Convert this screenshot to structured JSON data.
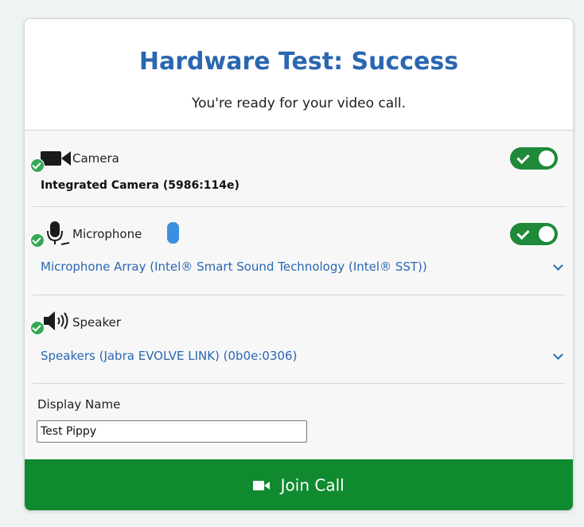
{
  "header": {
    "title": "Hardware Test: Success",
    "subtitle": "You're ready for your video call."
  },
  "camera": {
    "label": "Camera",
    "device": "Integrated Camera (5986:114e)",
    "enabled": true,
    "status": "ok"
  },
  "microphone": {
    "label": "Microphone",
    "device": "Microphone Array (Intel® Smart Sound Technology (Intel® SST))",
    "enabled": true,
    "status": "ok"
  },
  "speaker": {
    "label": "Speaker",
    "device": "Speakers (Jabra EVOLVE LINK) (0b0e:0306)",
    "status": "ok"
  },
  "display_name": {
    "label": "Display Name",
    "value": "Test Pippy"
  },
  "join_button": {
    "label_first": "J",
    "label_rest": "oin Call"
  },
  "colors": {
    "title": "#2a67b1",
    "toggle_on": "#1e8a3a",
    "join_bg": "#0f8a2f",
    "check": "#34a853"
  }
}
